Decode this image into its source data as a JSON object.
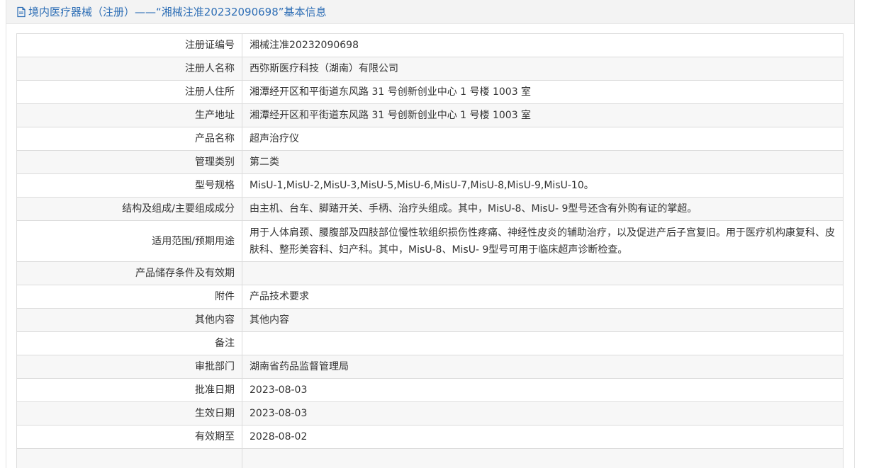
{
  "header": {
    "icon": "document-icon",
    "title": "境内医疗器械（注册）——“湘械注准20232090698”基本信息"
  },
  "rows": [
    {
      "label": "注册证编号",
      "value": "湘械注准20232090698"
    },
    {
      "label": "注册人名称",
      "value": "西弥斯医疗科技（湖南）有限公司"
    },
    {
      "label": "注册人住所",
      "value": "湘潭经开区和平街道东风路 31 号创新创业中心 1 号楼 1003 室"
    },
    {
      "label": "生产地址",
      "value": "湘潭经开区和平街道东风路 31 号创新创业中心 1 号楼 1003 室"
    },
    {
      "label": "产品名称",
      "value": "超声治疗仪"
    },
    {
      "label": "管理类别",
      "value": "第二类"
    },
    {
      "label": "型号规格",
      "value": "MisU-1,MisU-2,MisU-3,MisU-5,MisU-6,MisU-7,MisU-8,MisU-9,MisU-10。"
    },
    {
      "label": "结构及组成/主要组成成分",
      "value": "由主机、台车、脚踏开关、手柄、治疗头组成。其中，MisU-8、MisU- 9型号还含有外购有证的掌超。"
    },
    {
      "label": "适用范围/预期用途",
      "value": "用于人体肩颈、腰腹部及四肢部位慢性软组织损伤性疼痛、神经性皮炎的辅助治疗，以及促进产后子宫复旧。用于医疗机构康复科、皮肤科、整形美容科、妇产科。其中，MisU-8、MisU- 9型号可用于临床超声诊断检查。"
    },
    {
      "label": "产品储存条件及有效期",
      "value": ""
    },
    {
      "label": "附件",
      "value": "产品技术要求"
    },
    {
      "label": "其他内容",
      "value": "其他内容"
    },
    {
      "label": "备注",
      "value": ""
    },
    {
      "label": "审批部门",
      "value": "湖南省药品监督管理局"
    },
    {
      "label": "批准日期",
      "value": "2023-08-03"
    },
    {
      "label": "生效日期",
      "value": "2023-08-03"
    },
    {
      "label": "有效期至",
      "value": "2028-08-02"
    }
  ]
}
